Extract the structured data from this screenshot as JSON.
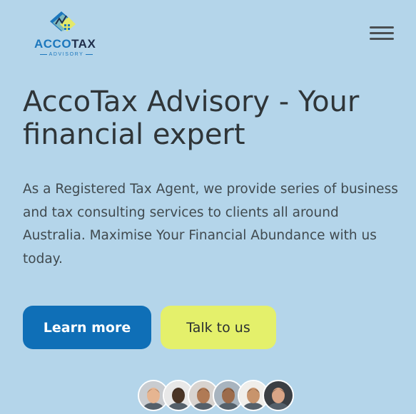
{
  "header": {
    "logo": {
      "name_part1": "ACCO",
      "name_part2": "TAX",
      "tagline": "ADVISORY",
      "icon": "logo-icon"
    },
    "menu_icon": "hamburger-menu-icon"
  },
  "hero": {
    "title": "AccoTax Advisory - Your financial expert",
    "description": "As a Registered Tax Agent, we provide series of business and tax consulting services to clients all around Australia. Maximise Your Financial Abundance with us today.",
    "buttons": {
      "learn_more": "Learn more",
      "talk_to_us": "Talk to us"
    }
  },
  "colors": {
    "background": "#b4d5ea",
    "primary_button": "#0f6fb7",
    "secondary_button": "#e4f06b",
    "brand_blue": "#1c77bd",
    "brand_dark": "#1f2d4a"
  },
  "avatars": [
    {
      "name": "avatar-1",
      "skin": "#e6b591",
      "bg": "#c9ccd0",
      "hair": "#6b4a2e"
    },
    {
      "name": "avatar-2",
      "skin": "#4a3526",
      "bg": "#e8e8e8",
      "hair": "#1c1512"
    },
    {
      "name": "avatar-3",
      "skin": "#b07a55",
      "bg": "#d8d3cf",
      "hair": "#1d1714"
    },
    {
      "name": "avatar-4",
      "skin": "#9c6b4b",
      "bg": "#a8b4bf",
      "hair": "#1a1410"
    },
    {
      "name": "avatar-5",
      "skin": "#c8946c",
      "bg": "#f0eeea",
      "hair": "#241a14"
    },
    {
      "name": "avatar-6",
      "skin": "#d9a587",
      "bg": "#3b3f44",
      "hair": "#2b1e16"
    }
  ]
}
